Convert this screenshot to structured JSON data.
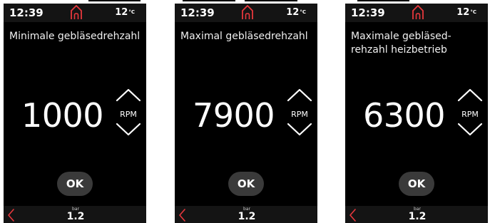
{
  "accent_color": "#e8383d",
  "screens": [
    {
      "time": "12:39",
      "temperature": "12",
      "temperature_unit": "°C",
      "title": "Minimale gebläsedrehzahl",
      "value": "1000",
      "unit": "RPM",
      "ok_label": "OK",
      "pressure_unit": "bar",
      "pressure_value": "1.2"
    },
    {
      "time": "12:39",
      "temperature": "12",
      "temperature_unit": "°C",
      "title": "Maximal gebläsedrehzahl",
      "value": "7900",
      "unit": "RPM",
      "ok_label": "OK",
      "pressure_unit": "bar",
      "pressure_value": "1.2"
    },
    {
      "time": "12:39",
      "temperature": "12",
      "temperature_unit": "°C",
      "title": "Maximale gebläsed-\nrehzahl heizbetrieb",
      "value": "6300",
      "unit": "RPM",
      "ok_label": "OK",
      "pressure_unit": "bar",
      "pressure_value": "1.2"
    }
  ]
}
